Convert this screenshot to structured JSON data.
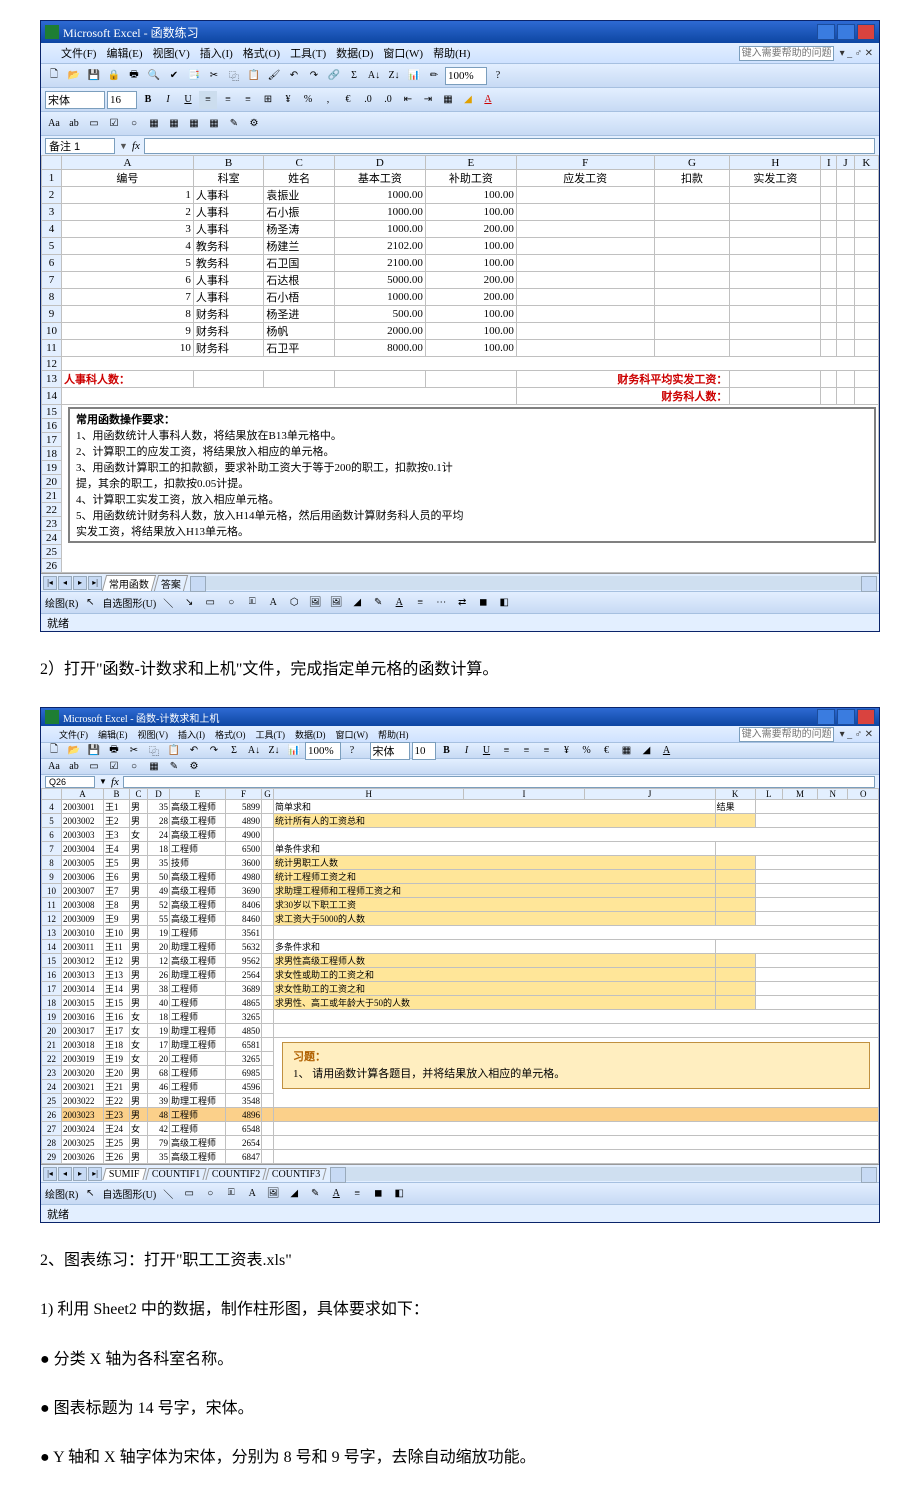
{
  "excel1": {
    "title": "Microsoft Excel - 函数练习",
    "menus": [
      "文件(F)",
      "编辑(E)",
      "视图(V)",
      "插入(I)",
      "格式(O)",
      "工具(T)",
      "数据(D)",
      "窗口(W)",
      "帮助(H)"
    ],
    "help_placeholder": "键入需要帮助的问题",
    "font": "宋体",
    "fontsize": "16",
    "zoom": "100%",
    "namebox": "备注 1",
    "cols": [
      "A",
      "B",
      "C",
      "D",
      "E",
      "F",
      "G",
      "H",
      "I",
      "J",
      "K"
    ],
    "headers": [
      "编号",
      "科室",
      "姓名",
      "基本工资",
      "补助工资",
      "应发工资",
      "扣款",
      "实发工资"
    ],
    "rows": [
      [
        "1",
        "人事科",
        "袁振业",
        "1000.00",
        "100.00"
      ],
      [
        "2",
        "人事科",
        "石小振",
        "1000.00",
        "100.00"
      ],
      [
        "3",
        "人事科",
        "杨圣涛",
        "1000.00",
        "200.00"
      ],
      [
        "4",
        "教务科",
        "杨建兰",
        "2102.00",
        "100.00"
      ],
      [
        "5",
        "教务科",
        "石卫国",
        "2100.00",
        "100.00"
      ],
      [
        "6",
        "人事科",
        "石达根",
        "5000.00",
        "200.00"
      ],
      [
        "7",
        "人事科",
        "石小梧",
        "1000.00",
        "200.00"
      ],
      [
        "8",
        "财务科",
        "杨圣进",
        "500.00",
        "100.00"
      ],
      [
        "9",
        "财务科",
        "杨帆",
        "2000.00",
        "100.00"
      ],
      [
        "10",
        "财务科",
        "石卫平",
        "8000.00",
        "100.00"
      ]
    ],
    "label_hr_count": "人事科人数：",
    "label_fin_avg": "财务科平均实发工资：",
    "label_fin_count": "财务科人数：",
    "instr_title": "常用函数操作要求：",
    "instr": [
      "1、用函数统计人事科人数，将结果放在B13单元格中。",
      "2、计算职工的应发工资，将结果放入相应的单元格。",
      "3、用函数计算职工的扣款额，要求补助工资大于等于200的职工，扣款按0.1计",
      "提，其余的职工，扣款按0.05计提。",
      "4、计算职工实发工资，放入相应单元格。",
      "5、用函数统计财务科人数，放入H14单元格，然后用函数计算财务科人员的平均",
      "实发工资，将结果放入H13单元格。"
    ],
    "tabs": [
      "常用函数",
      "答案"
    ],
    "drawbar_label": "绘图(R)",
    "autoshape_label": "自选图形(U)",
    "status": "就绪"
  },
  "text1": "2）打开\"函数-计数求和上机\"文件，完成指定单元格的函数计算。",
  "excel2": {
    "title": "Microsoft Excel - 函数-计数求和上机",
    "menus": [
      "文件(F)",
      "编辑(E)",
      "视图(V)",
      "插入(I)",
      "格式(O)",
      "工具(T)",
      "数据(D)",
      "窗口(W)",
      "帮助(H)"
    ],
    "help_placeholder": "键入需要帮助的问题",
    "font": "宋体",
    "fontsize": "10",
    "zoom": "100%",
    "namebox": "Q26",
    "cols": [
      "A",
      "B",
      "C",
      "D",
      "E",
      "F",
      "G",
      "H",
      "I",
      "J",
      "K",
      "L",
      "M",
      "N",
      "O"
    ],
    "rows": [
      [
        "4",
        "2003001",
        "王1",
        "男",
        "35",
        "高级工程师",
        "5899"
      ],
      [
        "5",
        "2003002",
        "王2",
        "男",
        "28",
        "高级工程师",
        "4890"
      ],
      [
        "6",
        "2003003",
        "王3",
        "女",
        "24",
        "高级工程师",
        "4900"
      ],
      [
        "7",
        "2003004",
        "王4",
        "男",
        "18",
        "工程师",
        "6500"
      ],
      [
        "8",
        "2003005",
        "王5",
        "男",
        "35",
        "技师",
        "3600"
      ],
      [
        "9",
        "2003006",
        "王6",
        "男",
        "50",
        "高级工程师",
        "4980"
      ],
      [
        "10",
        "2003007",
        "王7",
        "男",
        "49",
        "高级工程师",
        "3690"
      ],
      [
        "11",
        "2003008",
        "王8",
        "男",
        "52",
        "高级工程师",
        "8406"
      ],
      [
        "12",
        "2003009",
        "王9",
        "男",
        "55",
        "高级工程师",
        "8460"
      ],
      [
        "13",
        "2003010",
        "王10",
        "男",
        "19",
        "工程师",
        "3561"
      ],
      [
        "14",
        "2003011",
        "王11",
        "男",
        "20",
        "助理工程师",
        "5632"
      ],
      [
        "15",
        "2003012",
        "王12",
        "男",
        "12",
        "高级工程师",
        "9562"
      ],
      [
        "16",
        "2003013",
        "王13",
        "男",
        "26",
        "助理工程师",
        "2564"
      ],
      [
        "17",
        "2003014",
        "王14",
        "男",
        "38",
        "工程师",
        "3689"
      ],
      [
        "18",
        "2003015",
        "王15",
        "男",
        "40",
        "工程师",
        "4865"
      ],
      [
        "19",
        "2003016",
        "王16",
        "女",
        "18",
        "工程师",
        "3265"
      ],
      [
        "20",
        "2003017",
        "王17",
        "女",
        "19",
        "助理工程师",
        "4850"
      ],
      [
        "21",
        "2003018",
        "王18",
        "女",
        "17",
        "助理工程师",
        "6581"
      ],
      [
        "22",
        "2003019",
        "王19",
        "女",
        "20",
        "工程师",
        "3265"
      ],
      [
        "23",
        "2003020",
        "王20",
        "男",
        "68",
        "工程师",
        "6985"
      ],
      [
        "24",
        "2003021",
        "王21",
        "男",
        "46",
        "工程师",
        "4596"
      ],
      [
        "25",
        "2003022",
        "王22",
        "男",
        "39",
        "助理工程师",
        "3548"
      ],
      [
        "26",
        "2003023",
        "王23",
        "男",
        "48",
        "工程师",
        "4896"
      ],
      [
        "27",
        "2003024",
        "王24",
        "女",
        "42",
        "工程师",
        "6548"
      ],
      [
        "28",
        "2003025",
        "王25",
        "男",
        "79",
        "高级工程师",
        "2654"
      ],
      [
        "29",
        "2003026",
        "王26",
        "男",
        "35",
        "高级工程师",
        "6847"
      ]
    ],
    "simple_sum_title": "简单求和",
    "result_label": "结果",
    "simple_sum_items": [
      "统计所有人的工资总和"
    ],
    "single_cond_title": "单条件求和",
    "single_cond_items": [
      "统计男职工人数",
      "统计工程师工资之和",
      "求助理工程师和工程师工资之和",
      "求30岁以下职工工资",
      "求工资大于5000的人数"
    ],
    "multi_cond_title": "多条件求和",
    "multi_cond_items": [
      "求男性高级工程师人数",
      "求女性或助工的工资之和",
      "求女性助工的工资之和",
      "求男性、高工或年龄大于50的人数"
    ],
    "callout_title": "习题：",
    "callout_body": "1、 请用函数计算各题目，并将结果放入相应的单元格。",
    "tabs": [
      "SUMIF",
      "COUNTIF1",
      "COUNTIF2",
      "COUNTIF3"
    ],
    "drawbar_label": "绘图(R)",
    "autoshape_label": "自选图形(U)",
    "status": "就绪"
  },
  "text2": "2、图表练习：打开\"职工工资表.xls\"",
  "text3": "1) 利用 Sheet2 中的数据，制作柱形图，具体要求如下：",
  "text4": "● 分类 X 轴为各科室名称。",
  "text5": "● 图表标题为 14 号字，宋体。",
  "text6": "● Y 轴和 X 轴字体为宋体，分别为 8 号和 9 号字，去除自动缩放功能。"
}
